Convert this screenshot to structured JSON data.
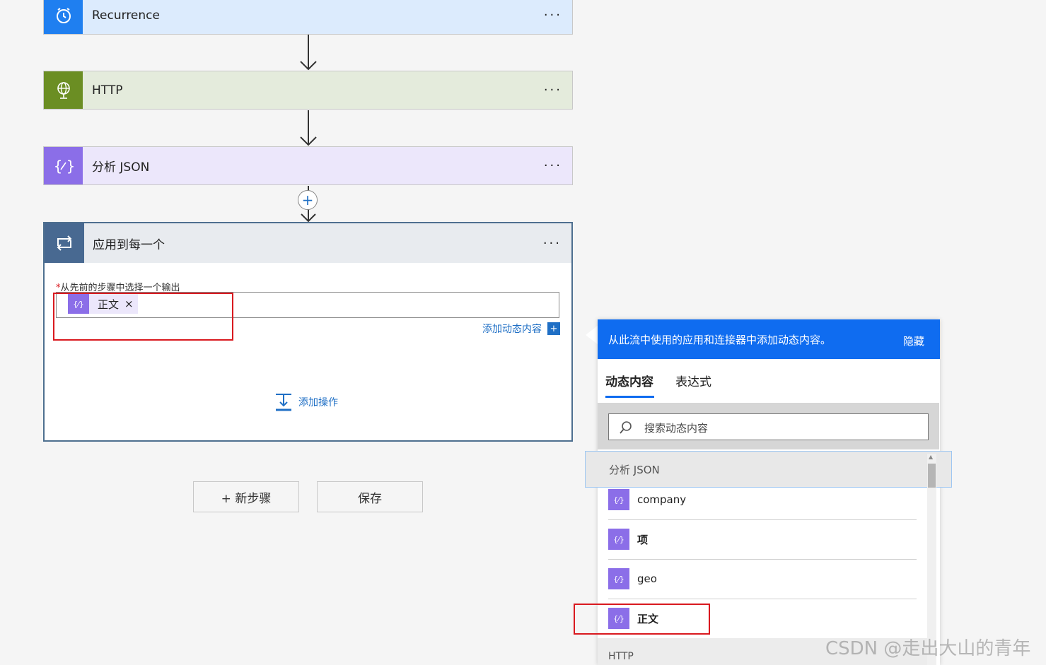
{
  "flow": {
    "recurrence": {
      "title": "Recurrence",
      "more": "···",
      "color": "#1f7ff0",
      "bg": "#dcebfd"
    },
    "http": {
      "title": "HTTP",
      "more": "···",
      "color": "#6b8e23",
      "bg": "#e4ebdc"
    },
    "parse_json": {
      "title": "分析 JSON",
      "more": "···",
      "color": "#8b6ee8",
      "bg": "#ece7fb"
    },
    "foreach": {
      "title": "应用到每一个",
      "more": "···",
      "required_mark": "*",
      "field_label": "从先前的步骤中选择一个输出",
      "token_label": "正文",
      "token_remove": "×",
      "add_dynamic": "添加动态内容",
      "add_dynamic_plus": "+",
      "add_action": "添加操作"
    }
  },
  "buttons": {
    "new_step": "+ 新步骤",
    "save": "保存"
  },
  "dynamic_panel": {
    "header_text": "从此流中使用的应用和连接器中添加动态内容。",
    "hide": "隐藏",
    "tabs": [
      "动态内容",
      "表达式"
    ],
    "search_placeholder": "搜索动态内容",
    "section_parse": "分析 JSON",
    "items": [
      "company",
      "项",
      "geo",
      "正文"
    ],
    "section_http": "HTTP",
    "accent": "#0f6cf0"
  },
  "watermark": "CSDN @走出大山的青年"
}
